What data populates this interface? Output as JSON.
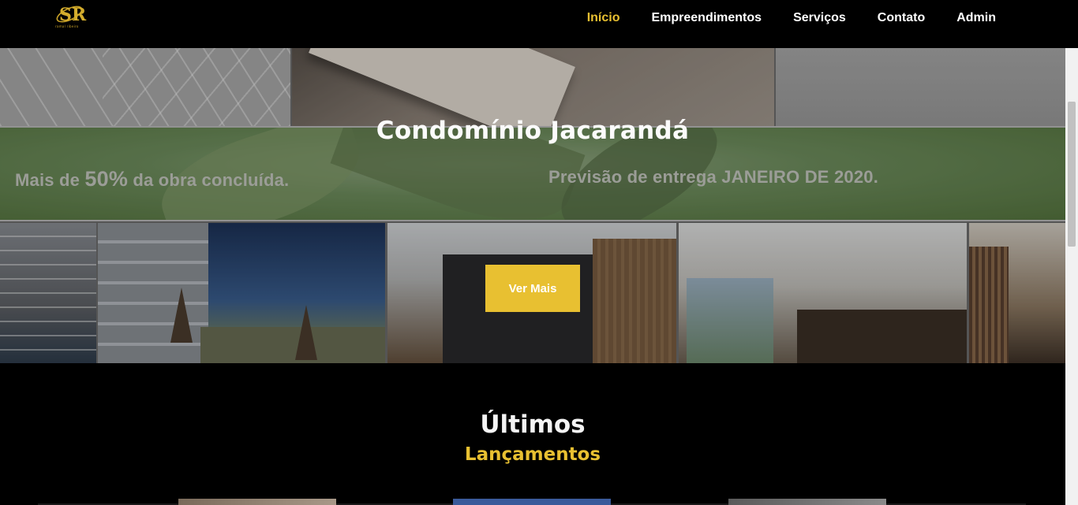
{
  "brand": {
    "logo_mark": "SR",
    "logo_subtitle": "ramal ribeiro"
  },
  "nav": {
    "items": [
      {
        "label": "Início",
        "active": true
      },
      {
        "label": "Empreendimentos",
        "active": false
      },
      {
        "label": "Serviços",
        "active": false
      },
      {
        "label": "Contato",
        "active": false
      },
      {
        "label": "Admin",
        "active": false
      }
    ]
  },
  "hero": {
    "title": "Condomínio Jacarandá",
    "banner_left_pre": "Mais de ",
    "banner_left_big": "50%",
    "banner_left_post": " da obra concluída.",
    "banner_right": "Previsão de entrega JANEIRO DE 2020.",
    "button_label": "Ver Mais"
  },
  "section": {
    "title": "Últimos",
    "subtitle": "Lançamentos"
  },
  "colors": {
    "accent": "#e8c031",
    "background": "#000000",
    "text": "#ffffff"
  }
}
